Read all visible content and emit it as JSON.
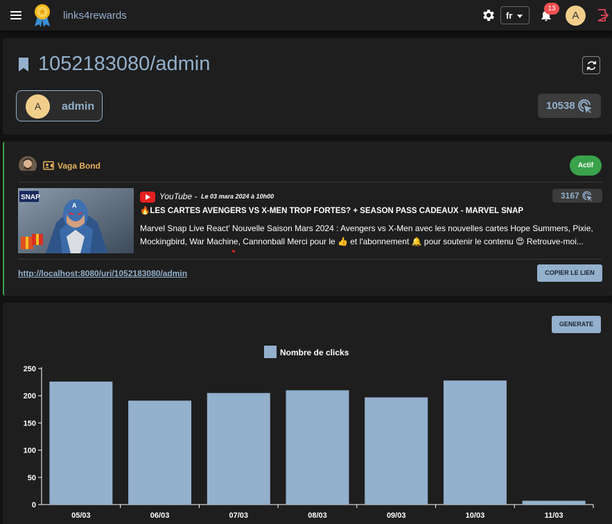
{
  "header": {
    "brand": "links4rewards",
    "language": "fr",
    "notification_count": "13",
    "user_initial": "A"
  },
  "link": {
    "title": "1052183080/admin",
    "owner_initial": "A",
    "owner_name": "admin",
    "total_clicks": "10538"
  },
  "video": {
    "author": "Vaga Bond",
    "status": "Actif",
    "source": "YouTube -",
    "date": "Le 03 mara 2024 à 10h00",
    "clicks": "3167",
    "title": "🔥LES CARTES AVENGERS VS X-MEN TROP FORTES? + SEASON PASS CADEAUX - MARVEL SNAP",
    "description": "Marvel Snap Live React' Nouvelle Saison Mars 2024 : Avengers vs X-Men avec les nouvelles cartes Hope Summers, Pixie, Mockingbird, War Machine, Cannonball Merci pour le 👍 et l'abonnement 🔔 pour soutenir le contenu 😍 Retrouve-moi...",
    "url": "http://localhost:8080/uri/1052183080/admin",
    "copy_label": "COPIER LE LIEN"
  },
  "chart_section": {
    "generate_label": "GENERATE"
  },
  "colors": {
    "accent": "#93b0cc",
    "active": "#3aa24a",
    "badge": "#f05050",
    "avatar": "#f1cf8b"
  },
  "chart_data": {
    "type": "bar",
    "categories": [
      "05/03",
      "06/03",
      "07/03",
      "08/03",
      "09/03",
      "10/03",
      "11/03"
    ],
    "series": [
      {
        "name": "Nombre de clicks",
        "values": [
          226,
          191,
          205,
          210,
          197,
          228,
          7
        ]
      }
    ],
    "ylim": [
      0,
      250
    ],
    "yticks": [
      0,
      50,
      100,
      150,
      200,
      250
    ],
    "legend": "top-center",
    "grid": false
  }
}
